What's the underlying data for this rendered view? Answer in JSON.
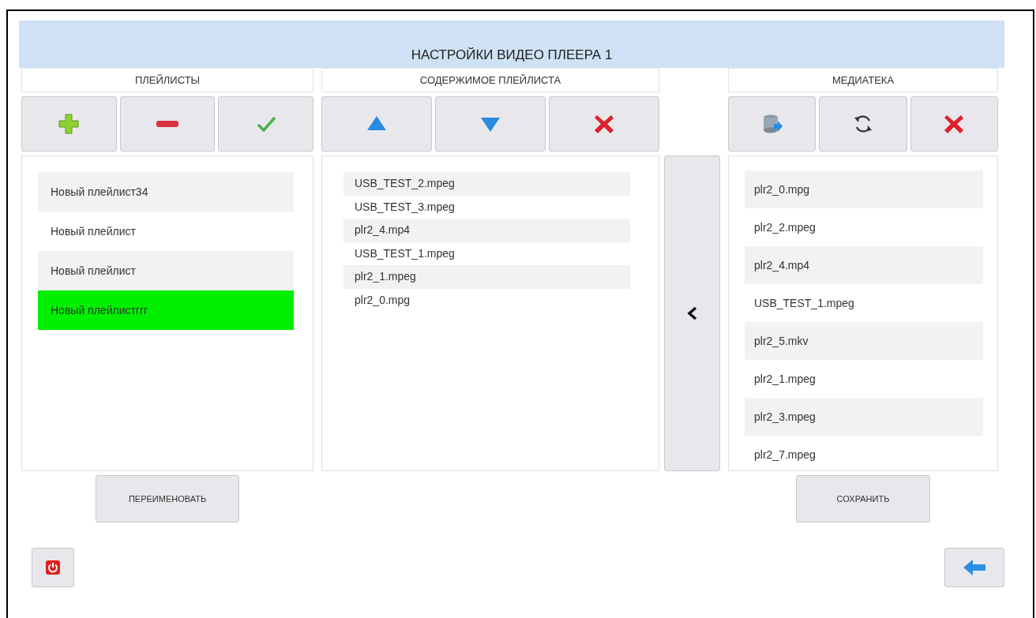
{
  "title": "НАСТРОЙКИ ВИДЕО ПЛЕЕРА 1",
  "playlists": {
    "heading": "ПЛЕЙЛИСТЫ",
    "items": [
      {
        "label": "Новый плейлист34",
        "selected": false
      },
      {
        "label": "Новый плейлист",
        "selected": false
      },
      {
        "label": "Новый плейлист",
        "selected": false
      },
      {
        "label": "Новый плейлистггг",
        "selected": true
      }
    ],
    "rename_button": "ПЕРЕИМЕНОВАТЬ"
  },
  "playlist_content": {
    "heading": "СОДЕРЖИМОЕ ПЛЕЙЛИСТА",
    "items": [
      "USB_TEST_2.mpeg",
      "USB_TEST_3.mpeg",
      "plr2_4.mp4",
      "USB_TEST_1.mpeg",
      "plr2_1.mpeg",
      "plr2_0.mpg"
    ]
  },
  "media_library": {
    "heading": "МЕДИАТЕКА",
    "items": [
      "plr2_0.mpg",
      "plr2_2.mpeg",
      "plr2_4.mp4",
      "USB_TEST_1.mpeg",
      "plr2_5.mkv",
      "plr2_1.mpeg",
      "plr2_3.mpeg",
      "plr2_7.mpeg"
    ],
    "save_button": "СОХРАНИТЬ"
  }
}
